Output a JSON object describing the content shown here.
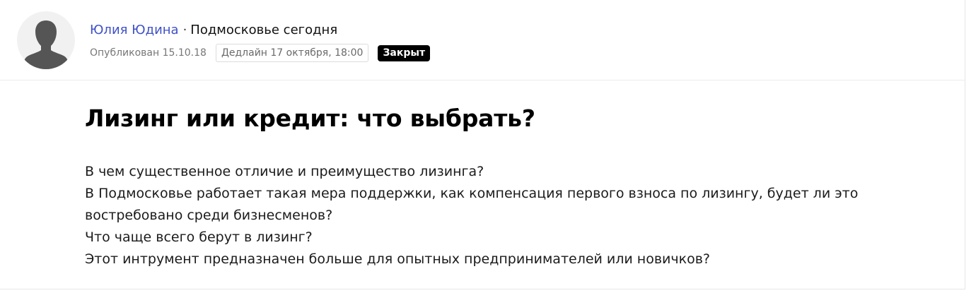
{
  "author": {
    "name": "Юлия Юдина",
    "separator": "·",
    "outlet": "Подмосковье сегодня"
  },
  "meta": {
    "published": "Опубликован 15.10.18",
    "deadline": "Дедлайн 17 октября, 18:00",
    "status": "Закрыт"
  },
  "article": {
    "title": "Лизинг или кредит: что выбрать?",
    "lines": [
      "В чем существенное отличие и преимущество лизинга?",
      "В Подмосковье работает такая мера поддержки, как компенсация первого взноса по лизингу, будет ли это",
      "востребовано среди бизнесменов?",
      "Что чаще всего берут в лизинг?",
      "Этот интрумент предназначен больше для опытных предпринимателей или новичков?"
    ]
  },
  "icons": {
    "avatar": "person-silhouette-icon"
  },
  "colors": {
    "author_link": "#3f51c7",
    "badge_bg": "#000000",
    "badge_text": "#ffffff",
    "avatar_bg": "#f1f1f1",
    "avatar_figure": "#555555"
  }
}
